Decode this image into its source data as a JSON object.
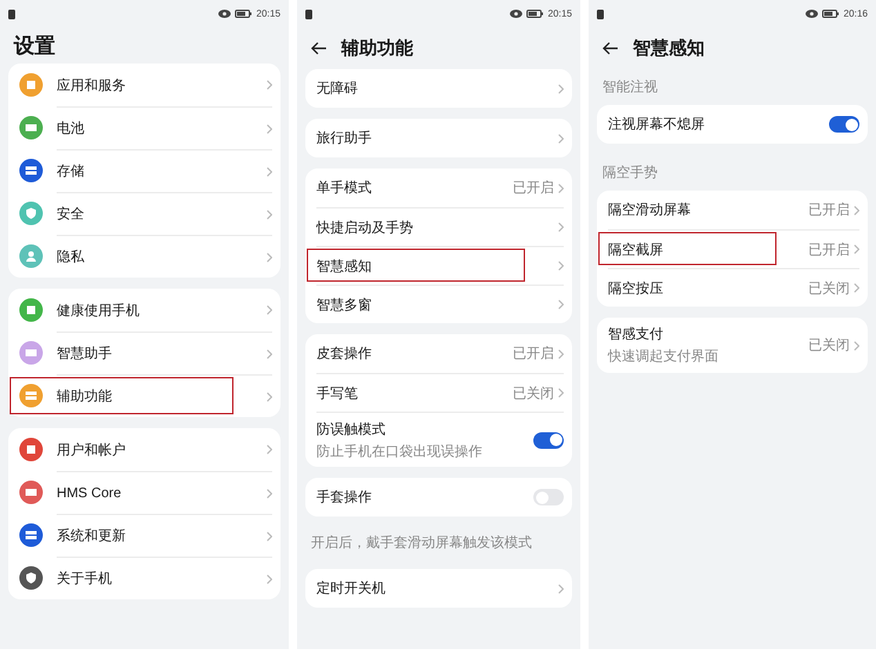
{
  "panels": [
    {
      "time": "20:15",
      "title": "设置",
      "back": false,
      "groups": [
        {
          "items": [
            {
              "label": "应用和服务",
              "kind": "link",
              "color": "#f0a030",
              "highlighted": false
            },
            {
              "label": "电池",
              "kind": "link",
              "color": "#4caf50",
              "highlighted": false
            },
            {
              "label": "存储",
              "kind": "link",
              "color": "#1e5bd8",
              "highlighted": false
            },
            {
              "label": "安全",
              "kind": "link",
              "color": "#4fc3b0",
              "highlighted": false
            },
            {
              "label": "隐私",
              "kind": "link",
              "color": "#5ec2b8",
              "highlighted": false
            }
          ]
        },
        {
          "items": [
            {
              "label": "健康使用手机",
              "kind": "link",
              "color": "#43b649",
              "highlighted": false
            },
            {
              "label": "智慧助手",
              "kind": "link",
              "color": "#c9a6e8",
              "highlighted": false
            },
            {
              "label": "辅助功能",
              "kind": "link",
              "color": "#f0a030",
              "highlighted": true
            }
          ]
        },
        {
          "items": [
            {
              "label": "用户和帐户",
              "kind": "link",
              "color": "#e0463a",
              "highlighted": false
            },
            {
              "label": "HMS Core",
              "kind": "link",
              "color": "#e05a58",
              "highlighted": false
            },
            {
              "label": "系统和更新",
              "kind": "link",
              "color": "#1e5bd8",
              "highlighted": false
            },
            {
              "label": "关于手机",
              "kind": "link",
              "color": "#555555",
              "highlighted": false
            }
          ]
        }
      ]
    },
    {
      "time": "20:15",
      "title": "辅助功能",
      "back": true,
      "groups": [
        {
          "items": [
            {
              "label": "无障碍",
              "kind": "link",
              "highlighted": false
            }
          ]
        },
        {
          "items": [
            {
              "label": "旅行助手",
              "kind": "link",
              "highlighted": false
            }
          ]
        },
        {
          "items": [
            {
              "label": "单手模式",
              "kind": "link",
              "value": "已开启",
              "highlighted": false
            },
            {
              "label": "快捷启动及手势",
              "kind": "link",
              "highlighted": false
            },
            {
              "label": "智慧感知",
              "kind": "link",
              "highlighted": true
            },
            {
              "label": "智慧多窗",
              "kind": "link",
              "highlighted": false
            }
          ]
        },
        {
          "items": [
            {
              "label": "皮套操作",
              "kind": "link",
              "value": "已开启",
              "highlighted": false
            },
            {
              "label": "手写笔",
              "kind": "link",
              "value": "已关闭",
              "highlighted": false
            },
            {
              "label": "防误触模式",
              "subtitle": "防止手机在口袋出现误操作",
              "kind": "toggle",
              "on": true,
              "highlighted": false
            }
          ]
        },
        {
          "items": [
            {
              "label": "手套操作",
              "kind": "toggle",
              "on": false,
              "highlighted": false
            }
          ],
          "note": "开启后，戴手套滑动屏幕触发该模式"
        },
        {
          "items": [
            {
              "label": "定时开关机",
              "kind": "link",
              "highlighted": false
            }
          ]
        }
      ]
    },
    {
      "time": "20:16",
      "title": "智慧感知",
      "back": true,
      "groups": [
        {
          "section": "智能注视",
          "items": [
            {
              "label": "注视屏幕不熄屏",
              "kind": "toggle",
              "on": true,
              "highlighted": false
            }
          ]
        },
        {
          "section": "隔空手势",
          "items": [
            {
              "label": "隔空滑动屏幕",
              "kind": "link",
              "value": "已开启",
              "highlighted": false
            },
            {
              "label": "隔空截屏",
              "kind": "link",
              "value": "已开启",
              "highlighted": true
            },
            {
              "label": "隔空按压",
              "kind": "link",
              "value": "已关闭",
              "highlighted": false
            }
          ]
        },
        {
          "items": [
            {
              "label": "智感支付",
              "subtitle": "快速调起支付界面",
              "kind": "link",
              "value": "已关闭",
              "highlighted": false
            }
          ]
        }
      ]
    }
  ]
}
